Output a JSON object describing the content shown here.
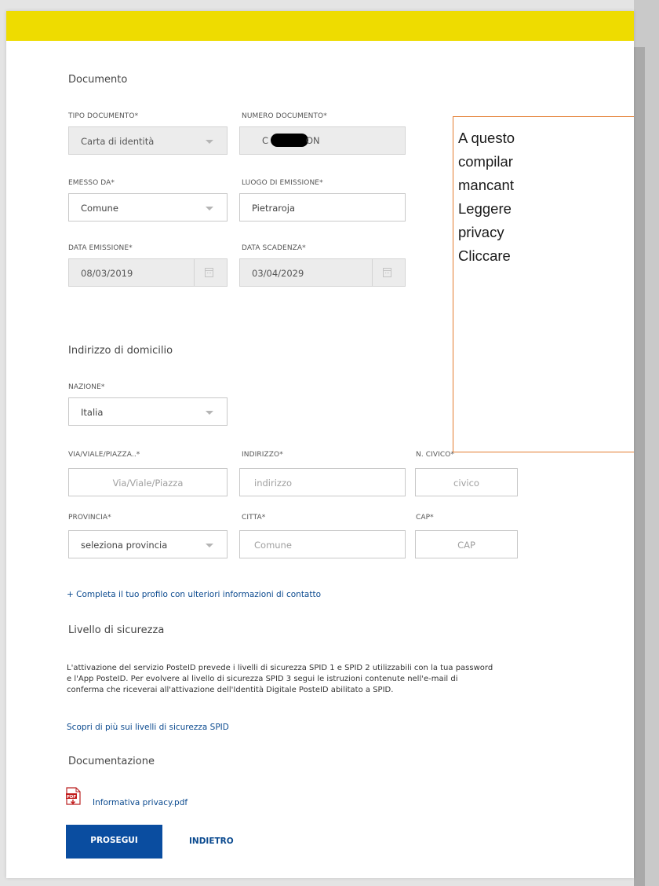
{
  "form": {
    "documento": {
      "title": "Documento",
      "tipo_label": "TIPO DOCUMENTO*",
      "tipo_value": "Carta di identità",
      "numero_label": "NUMERO DOCUMENTO*",
      "numero_visible_start": "C",
      "numero_visible_end": "ON",
      "emesso_label": "EMESSO DA*",
      "emesso_value": "Comune",
      "luogo_label": "LUOGO DI EMISSIONE*",
      "luogo_value": "Pietraroja",
      "data_emissione_label": "DATA EMISSIONE*",
      "data_emissione_value": "08/03/2019",
      "data_scadenza_label": "DATA SCADENZA*",
      "data_scadenza_value": "03/04/2029"
    },
    "domicilio": {
      "title": "Indirizzo di domicilio",
      "nazione_label": "NAZIONE*",
      "nazione_value": "Italia",
      "via_label": "VIA/VIALE/PIAZZA..*",
      "via_placeholder": "Via/Viale/Piazza",
      "indirizzo_label": "INDIRIZZO*",
      "indirizzo_placeholder": "indirizzo",
      "civico_label": "N. CIVICO*",
      "civico_placeholder": "civico",
      "provincia_label": "PROVINCIA*",
      "provincia_value": "seleziona provincia",
      "citta_label": "CITTA*",
      "citta_placeholder": "Comune",
      "cap_label": "CAP*",
      "cap_placeholder": "CAP"
    },
    "complete_profile_link": "+ Completa il tuo profilo con ulteriori informazioni di contatto",
    "sicurezza": {
      "title": "Livello di sicurezza",
      "lines": [
        "L'attivazione del servizio PosteID prevede i livelli di sicurezza SPID 1 e SPID 2 utilizzabili con la tua password",
        "e l'App PosteID. Per evolvere al livello di sicurezza SPID 3 segui le istruzioni contenute nell'e-mail di",
        "conferma che riceverai all'attivazione dell'Identità Digitale PosteID abilitato a SPID."
      ],
      "link": "Scopri di più sui livelli di sicurezza SPID"
    },
    "documentazione": {
      "title": "Documentazione",
      "file_link": "Informativa privacy.pdf"
    },
    "buttons": {
      "prosegui": "PROSEGUI",
      "indietro": "INDIETRO"
    }
  },
  "callout": {
    "lines": [
      "A questo",
      "compilar",
      "mancant",
      "Leggere",
      "privacy",
      "Cliccare"
    ]
  },
  "colors": {
    "top_bar": "#eedc00",
    "primary_button": "#0a4da0",
    "link": "#0b4a8f",
    "callout_border": "#e37b2f"
  }
}
